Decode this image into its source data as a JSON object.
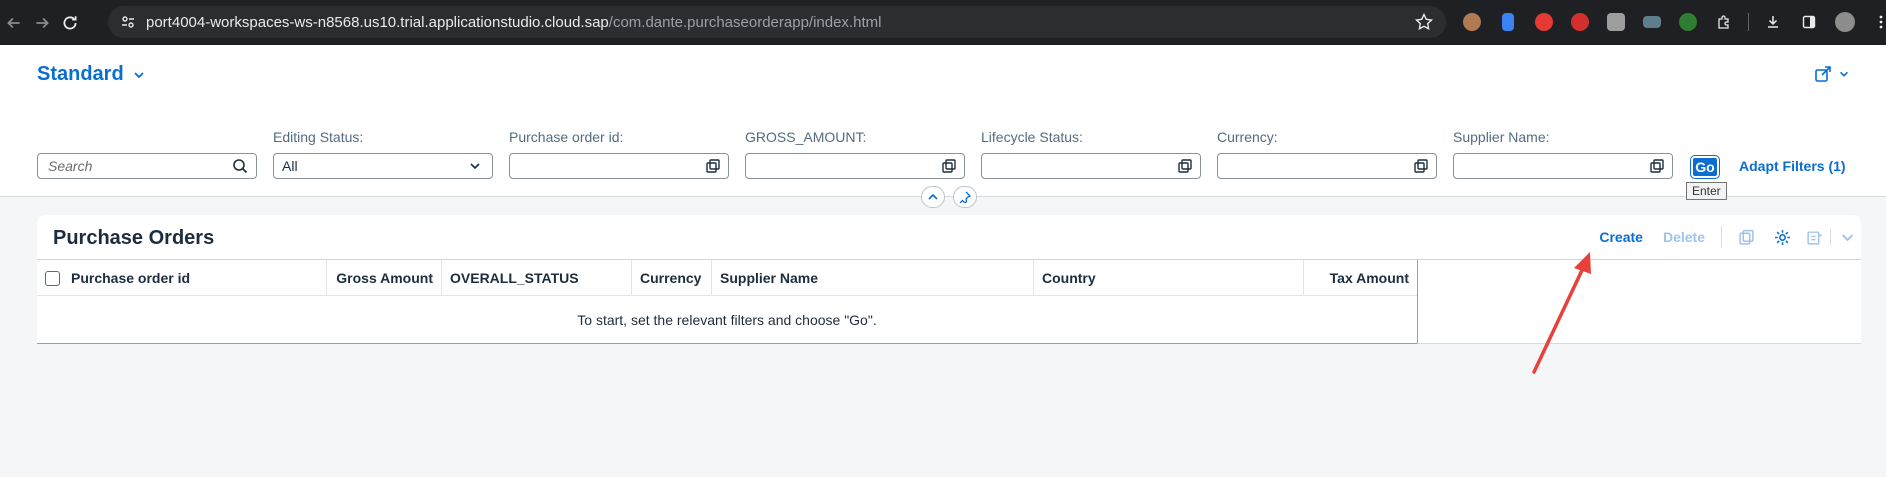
{
  "browser": {
    "url_host": "port4004-workspaces-ws-n8568.us10.trial.applicationstudio.cloud.sap",
    "url_path": "/com.dante.purchaseorderapp/index.html",
    "extensions": [
      "extension-1",
      "extension-2",
      "extension-3",
      "adblock-icon",
      "extension-5",
      "extension-6",
      "extension-7",
      "puzzle-icon"
    ],
    "colors": {
      "frame": "#1f2023",
      "omnibox": "#2c2d30"
    }
  },
  "header": {
    "variant_title": "Standard",
    "search_placeholder": "Search",
    "filters": [
      {
        "label": "Editing Status:",
        "value": "All",
        "type": "select"
      },
      {
        "label": "Purchase order id:",
        "value": "",
        "type": "input"
      },
      {
        "label": "GROSS_AMOUNT:",
        "value": "",
        "type": "input"
      },
      {
        "label": "Lifecycle Status:",
        "value": "",
        "type": "input"
      },
      {
        "label": "Currency:",
        "value": "",
        "type": "input"
      },
      {
        "label": "Supplier Name:",
        "value": "",
        "type": "input"
      }
    ],
    "go_label": "Go",
    "adapt_filters_label": "Adapt Filters (1)",
    "tooltip": "Enter"
  },
  "table": {
    "title": "Purchase Orders",
    "create_label": "Create",
    "delete_label": "Delete",
    "columns": [
      "Purchase order id",
      "Gross Amount",
      "OVERALL_STATUS",
      "Currency",
      "Supplier Name",
      "Country",
      "Tax Amount"
    ],
    "no_data_text": "To start, set the relevant filters and choose \"Go\"."
  },
  "colors": {
    "accent": "#0a6ed1",
    "annotation_arrow": "#e8403a"
  }
}
